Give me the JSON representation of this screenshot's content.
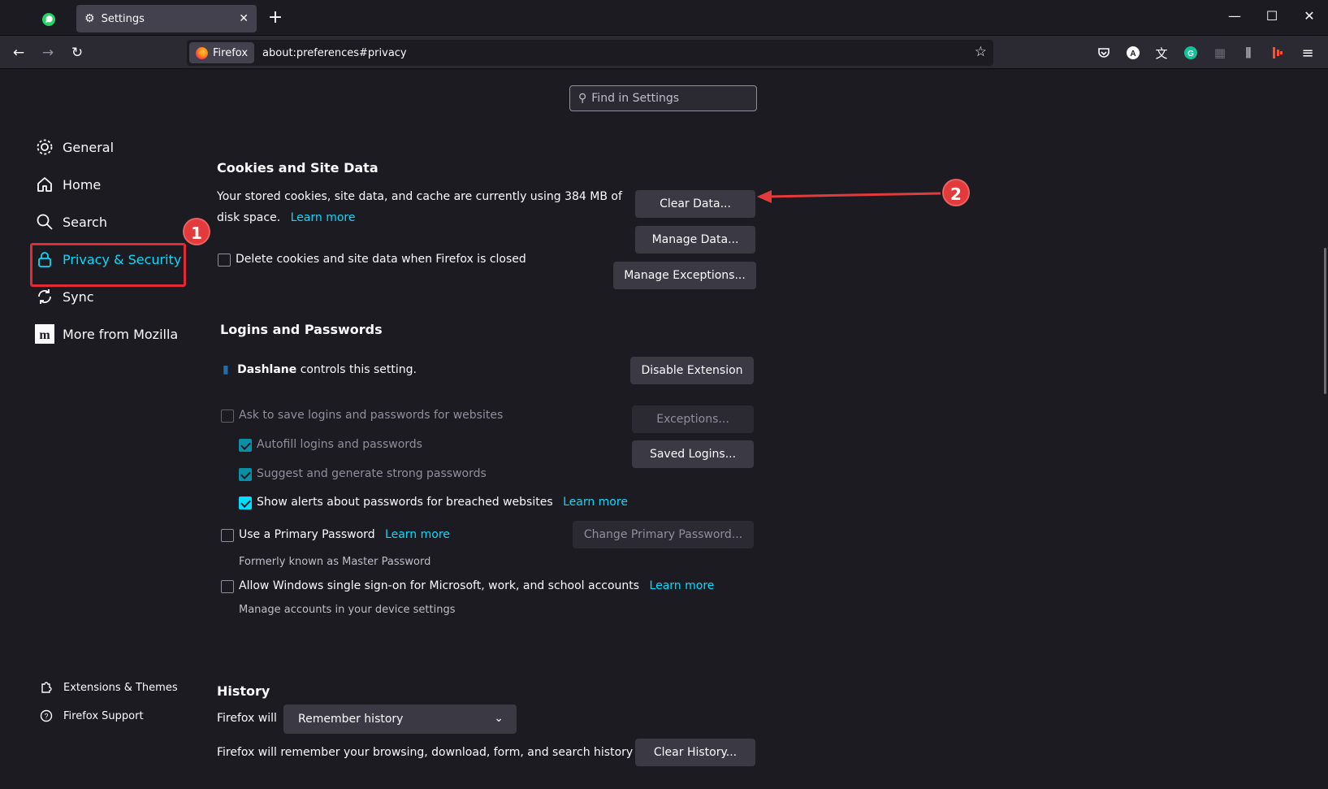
{
  "browser": {
    "tab_title": "Settings",
    "identity_label": "Firefox",
    "url": "about:preferences#privacy"
  },
  "search": {
    "placeholder": "Find in Settings"
  },
  "sidebar": {
    "items": [
      {
        "label": "General",
        "icon": "gear-icon"
      },
      {
        "label": "Home",
        "icon": "home-icon"
      },
      {
        "label": "Search",
        "icon": "search-icon"
      },
      {
        "label": "Privacy & Security",
        "icon": "lock-icon",
        "selected": true
      },
      {
        "label": "Sync",
        "icon": "sync-icon"
      },
      {
        "label": "More from Mozilla",
        "icon": "mozilla-icon"
      }
    ],
    "footer": [
      {
        "label": "Extensions & Themes",
        "icon": "puzzle-icon"
      },
      {
        "label": "Firefox Support",
        "icon": "help-icon"
      }
    ]
  },
  "annotations": {
    "badge1": "1",
    "badge2": "2",
    "accent": "#e22a36"
  },
  "cookies": {
    "title": "Cookies and Site Data",
    "desc_line1": "Your stored cookies, site data, and cache are currently using 384 MB of",
    "desc_line2": "disk space.",
    "learn_more": "Learn more",
    "clear_data": "Clear Data...",
    "manage_data": "Manage Data...",
    "manage_exceptions": "Manage Exceptions...",
    "delete_on_close": "Delete cookies and site data when Firefox is closed"
  },
  "logins": {
    "title": "Logins and Passwords",
    "controller_name": "Dashlane",
    "controller_text": "controls this setting.",
    "disable_extension": "Disable Extension",
    "ask_to_save": "Ask to save logins and passwords for websites",
    "exceptions": "Exceptions...",
    "saved_logins": "Saved Logins...",
    "autofill": "Autofill logins and passwords",
    "suggest": "Suggest and generate strong passwords",
    "breach_alerts": "Show alerts about passwords for breached websites",
    "learn_more": "Learn more",
    "primary_password": "Use a Primary Password",
    "change_primary": "Change Primary Password...",
    "formerly": "Formerly known as Master Password",
    "windows_sso": "Allow Windows single sign-on for Microsoft, work, and school accounts",
    "manage_accounts": "Manage accounts in your device settings"
  },
  "history": {
    "title": "History",
    "firefox_will": "Firefox will",
    "select_value": "Remember history",
    "desc": "Firefox will remember your browsing, download, form, and search history",
    "clear_history": "Clear History..."
  },
  "colors": {
    "accent": "#00ddff",
    "bg": "#1c1b22"
  }
}
